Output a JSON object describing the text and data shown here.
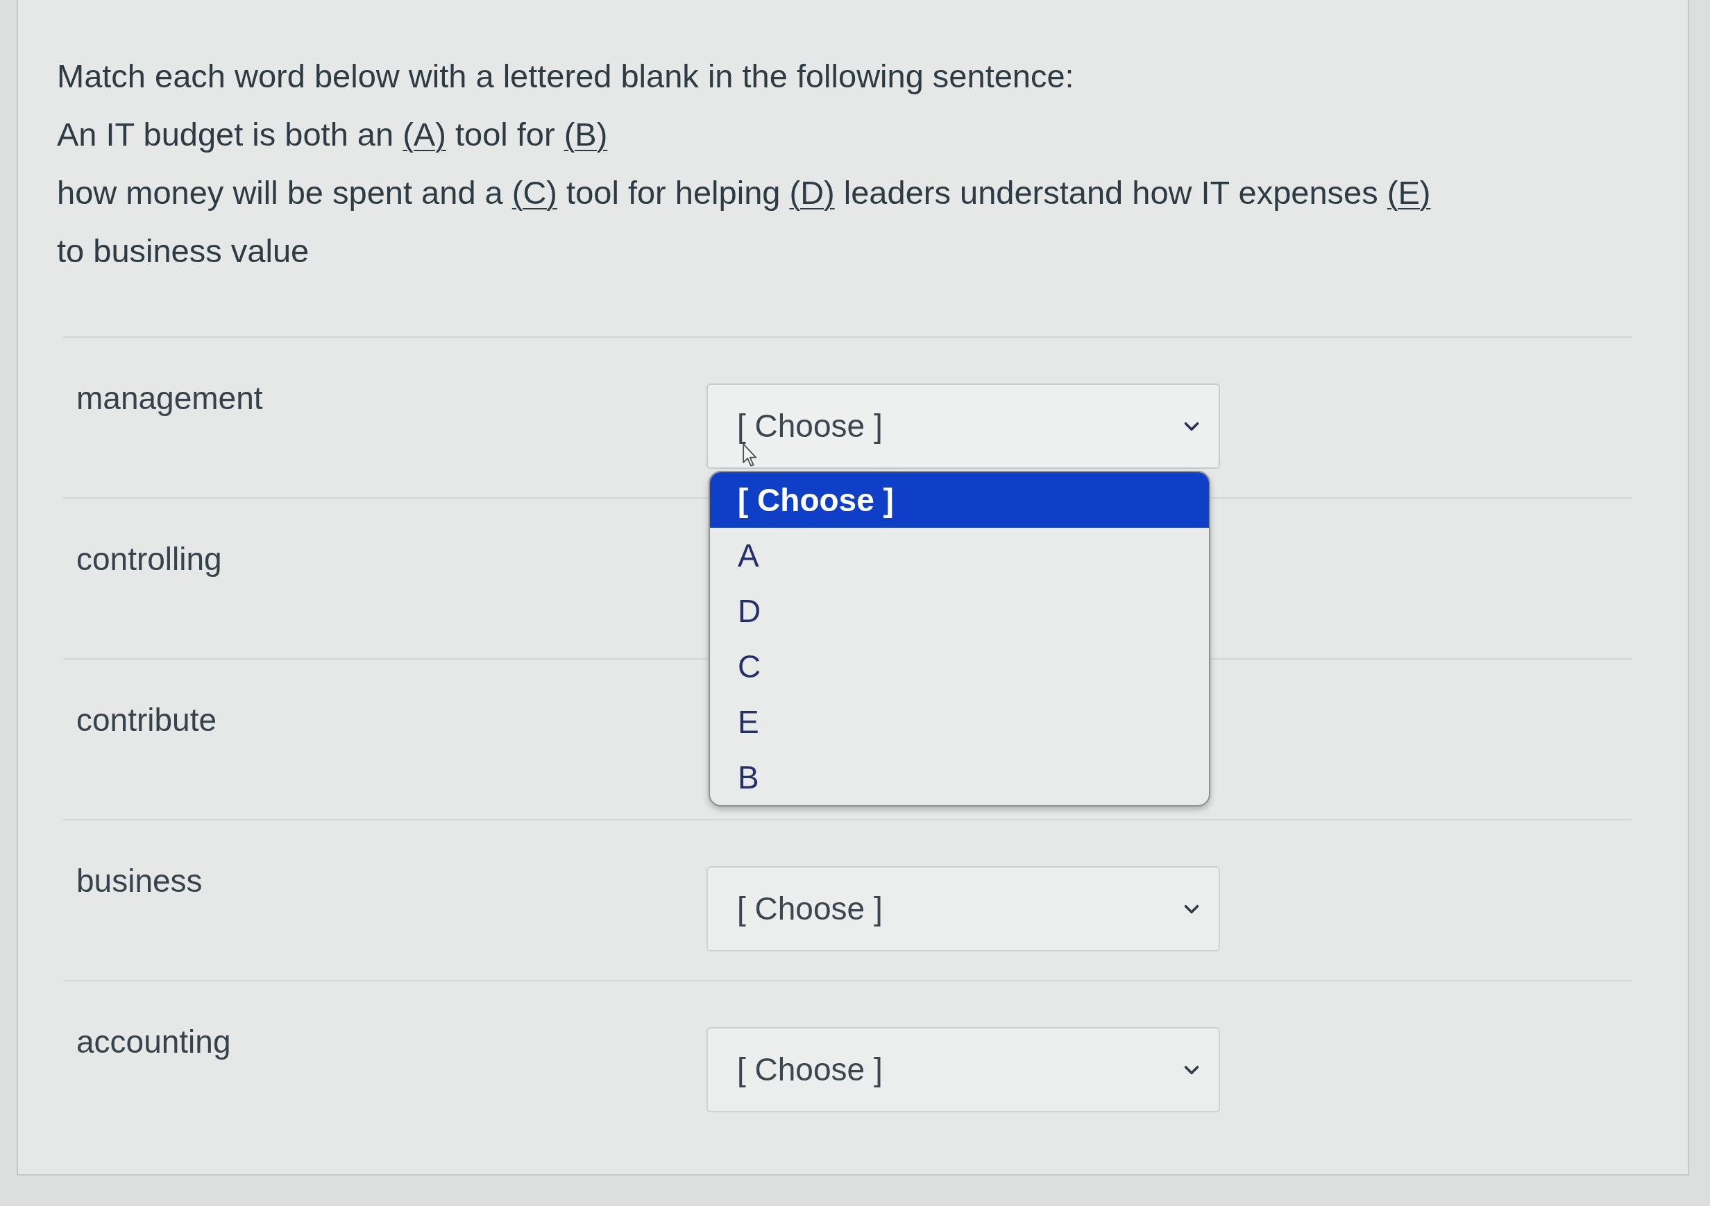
{
  "question": {
    "prompt": "Match each word below with a lettered blank in the following sentence:",
    "sentence": [
      {
        "kind": "text",
        "text": "An IT budget is both an "
      },
      {
        "kind": "blank",
        "text": "(A)"
      },
      {
        "kind": "text",
        "text": " tool for "
      },
      {
        "kind": "blank",
        "text": "(B)"
      },
      {
        "kind": "break"
      },
      {
        "kind": "text",
        "text": "how money will be spent and a "
      },
      {
        "kind": "blank",
        "text": "(C)"
      },
      {
        "kind": "text",
        "text": " tool for helping "
      },
      {
        "kind": "blank",
        "text": "(D)"
      },
      {
        "kind": "text",
        "text": " leaders understand how IT expenses "
      },
      {
        "kind": "blank",
        "text": "(E)"
      },
      {
        "kind": "break"
      },
      {
        "kind": "text",
        "text": "to business value"
      }
    ]
  },
  "answers": [
    {
      "word": "management",
      "select": {
        "value": "[ Choose ]",
        "open": true,
        "options": [
          {
            "label": "[ Choose ]",
            "selected": true
          },
          {
            "label": "A",
            "selected": false
          },
          {
            "label": "D",
            "selected": false
          },
          {
            "label": "C",
            "selected": false
          },
          {
            "label": "E",
            "selected": false
          },
          {
            "label": "B",
            "selected": false
          }
        ]
      }
    },
    {
      "word": "controlling"
    },
    {
      "word": "contribute"
    },
    {
      "word": "business",
      "select": {
        "value": "[ Choose ]",
        "open": false
      }
    },
    {
      "word": "accounting",
      "select": {
        "value": "[ Choose ]",
        "open": false
      }
    }
  ]
}
